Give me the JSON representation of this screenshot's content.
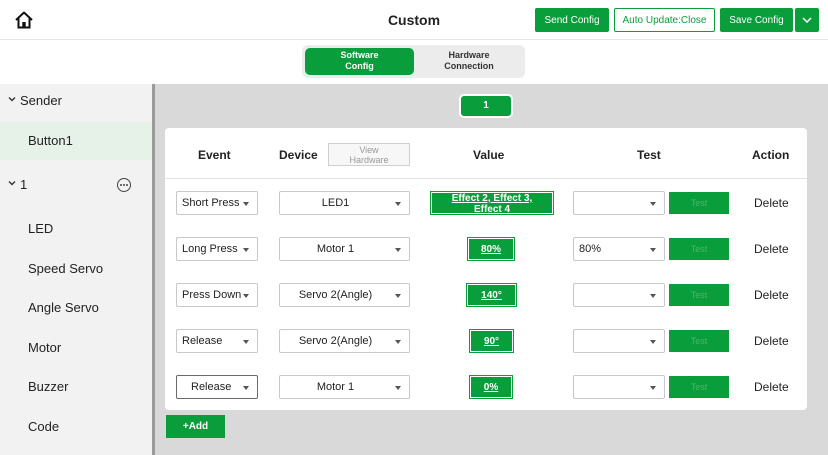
{
  "header": {
    "title": "Custom",
    "send_config": "Send Config",
    "auto_update": "Auto Update:Close",
    "save_config": "Save Config"
  },
  "config_toggle": {
    "software_line1": "Software",
    "software_line2": "Config",
    "hardware_line1": "Hardware",
    "hardware_line2": "Connection"
  },
  "sidebar": {
    "group_sender": "Sender",
    "item_button1": "Button1",
    "group_1": "1",
    "items": [
      "LED",
      "Speed Servo",
      "Angle Servo",
      "Motor",
      "Buzzer",
      "Code"
    ]
  },
  "main": {
    "tab": "1",
    "columns": {
      "event": "Event",
      "device": "Device",
      "value": "Value",
      "test": "Test",
      "action": "Action"
    },
    "view_hardware_line1": "View",
    "view_hardware_line2": "Hardware",
    "rows": [
      {
        "event": "Short Press",
        "device": "LED1",
        "value_line1": "Effect 2, Effect 3,",
        "value_line2": "Effect 4",
        "test": "",
        "test_button": "Test",
        "action": "Delete"
      },
      {
        "event": "Long Press",
        "device": "Motor 1",
        "value_line1": "80%",
        "value_line2": "",
        "test": "80%",
        "test_button": "Test",
        "action": "Delete"
      },
      {
        "event": "Press Down",
        "device": "Servo 2(Angle)",
        "value_line1": "140°",
        "value_line2": "",
        "test": "",
        "test_button": "Test",
        "action": "Delete"
      },
      {
        "event": "Release",
        "device": "Servo 2(Angle)",
        "value_line1": "90°",
        "value_line2": "",
        "test": "",
        "test_button": "Test",
        "action": "Delete"
      },
      {
        "event": "Release",
        "device": "Motor 1",
        "value_line1": "0%",
        "value_line2": "",
        "test": "",
        "test_button": "Test",
        "action": "Delete"
      }
    ],
    "add_button": "+Add"
  },
  "colors": {
    "accent": "#0a9d3c",
    "sidebar_bg": "#f2f2f2",
    "panel_bg": "#d9d9d9",
    "selected_item_bg": "#e6f1e8"
  },
  "icons": [
    "home-icon",
    "chevron-down-icon",
    "more-options-icon",
    "dropdown-arrow-icon"
  ]
}
